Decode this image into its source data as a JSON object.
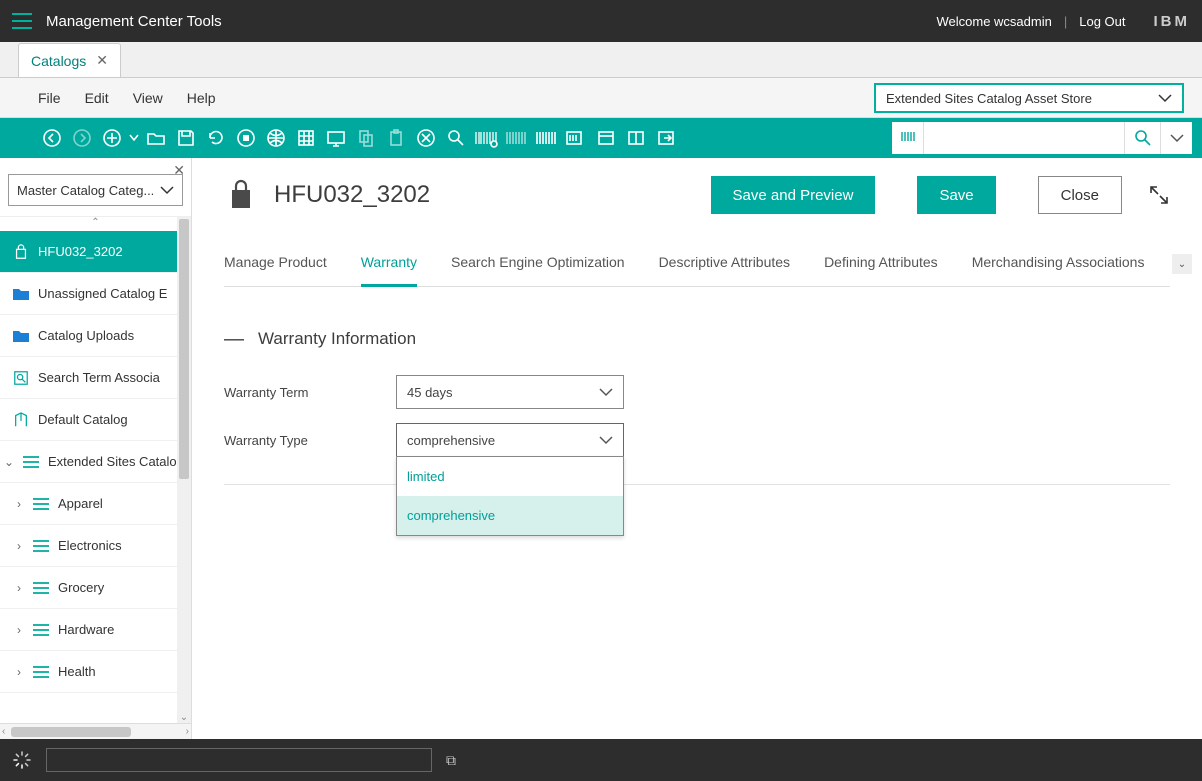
{
  "topbar": {
    "title": "Management Center Tools",
    "welcome": "Welcome wcsadmin",
    "logout": "Log Out",
    "brand": "IBM"
  },
  "tabs": {
    "current": "Catalogs"
  },
  "menus": {
    "file": "File",
    "edit": "Edit",
    "view": "View",
    "help": "Help"
  },
  "store_selector": "Extended Sites Catalog Asset Store",
  "left": {
    "filter": "Master Catalog Categ...",
    "items": [
      {
        "label": "HFU032_3202",
        "icon": "bag",
        "selected": true
      },
      {
        "label": "Unassigned Catalog E",
        "icon": "folder"
      },
      {
        "label": "Catalog Uploads",
        "icon": "folder"
      },
      {
        "label": "Search Term Associa",
        "icon": "search-assoc"
      },
      {
        "label": "Default Catalog",
        "icon": "default-cat"
      },
      {
        "label": "Extended Sites Catalo",
        "icon": "cat",
        "expand": "v"
      },
      {
        "label": "Apparel",
        "icon": "cat",
        "expand": ">"
      },
      {
        "label": "Electronics",
        "icon": "cat",
        "expand": ">"
      },
      {
        "label": "Grocery",
        "icon": "cat",
        "expand": ">"
      },
      {
        "label": "Hardware",
        "icon": "cat",
        "expand": ">"
      },
      {
        "label": "Health",
        "icon": "cat",
        "expand": ">"
      }
    ]
  },
  "page": {
    "title": "HFU032_3202",
    "save_preview": "Save and Preview",
    "save": "Save",
    "close": "Close"
  },
  "ptabs": {
    "t0": "Manage Product",
    "t1": "Warranty",
    "t2": "Search Engine Optimization",
    "t3": "Descriptive Attributes",
    "t4": "Defining Attributes",
    "t5": "Merchandising Associations"
  },
  "section": {
    "title": "Warranty Information"
  },
  "form": {
    "term_label": "Warranty Term",
    "term_value": "45 days",
    "type_label": "Warranty Type",
    "type_value": "comprehensive",
    "type_options": {
      "o0": "limited",
      "o1": "comprehensive"
    }
  },
  "status": {
    "value": ""
  }
}
